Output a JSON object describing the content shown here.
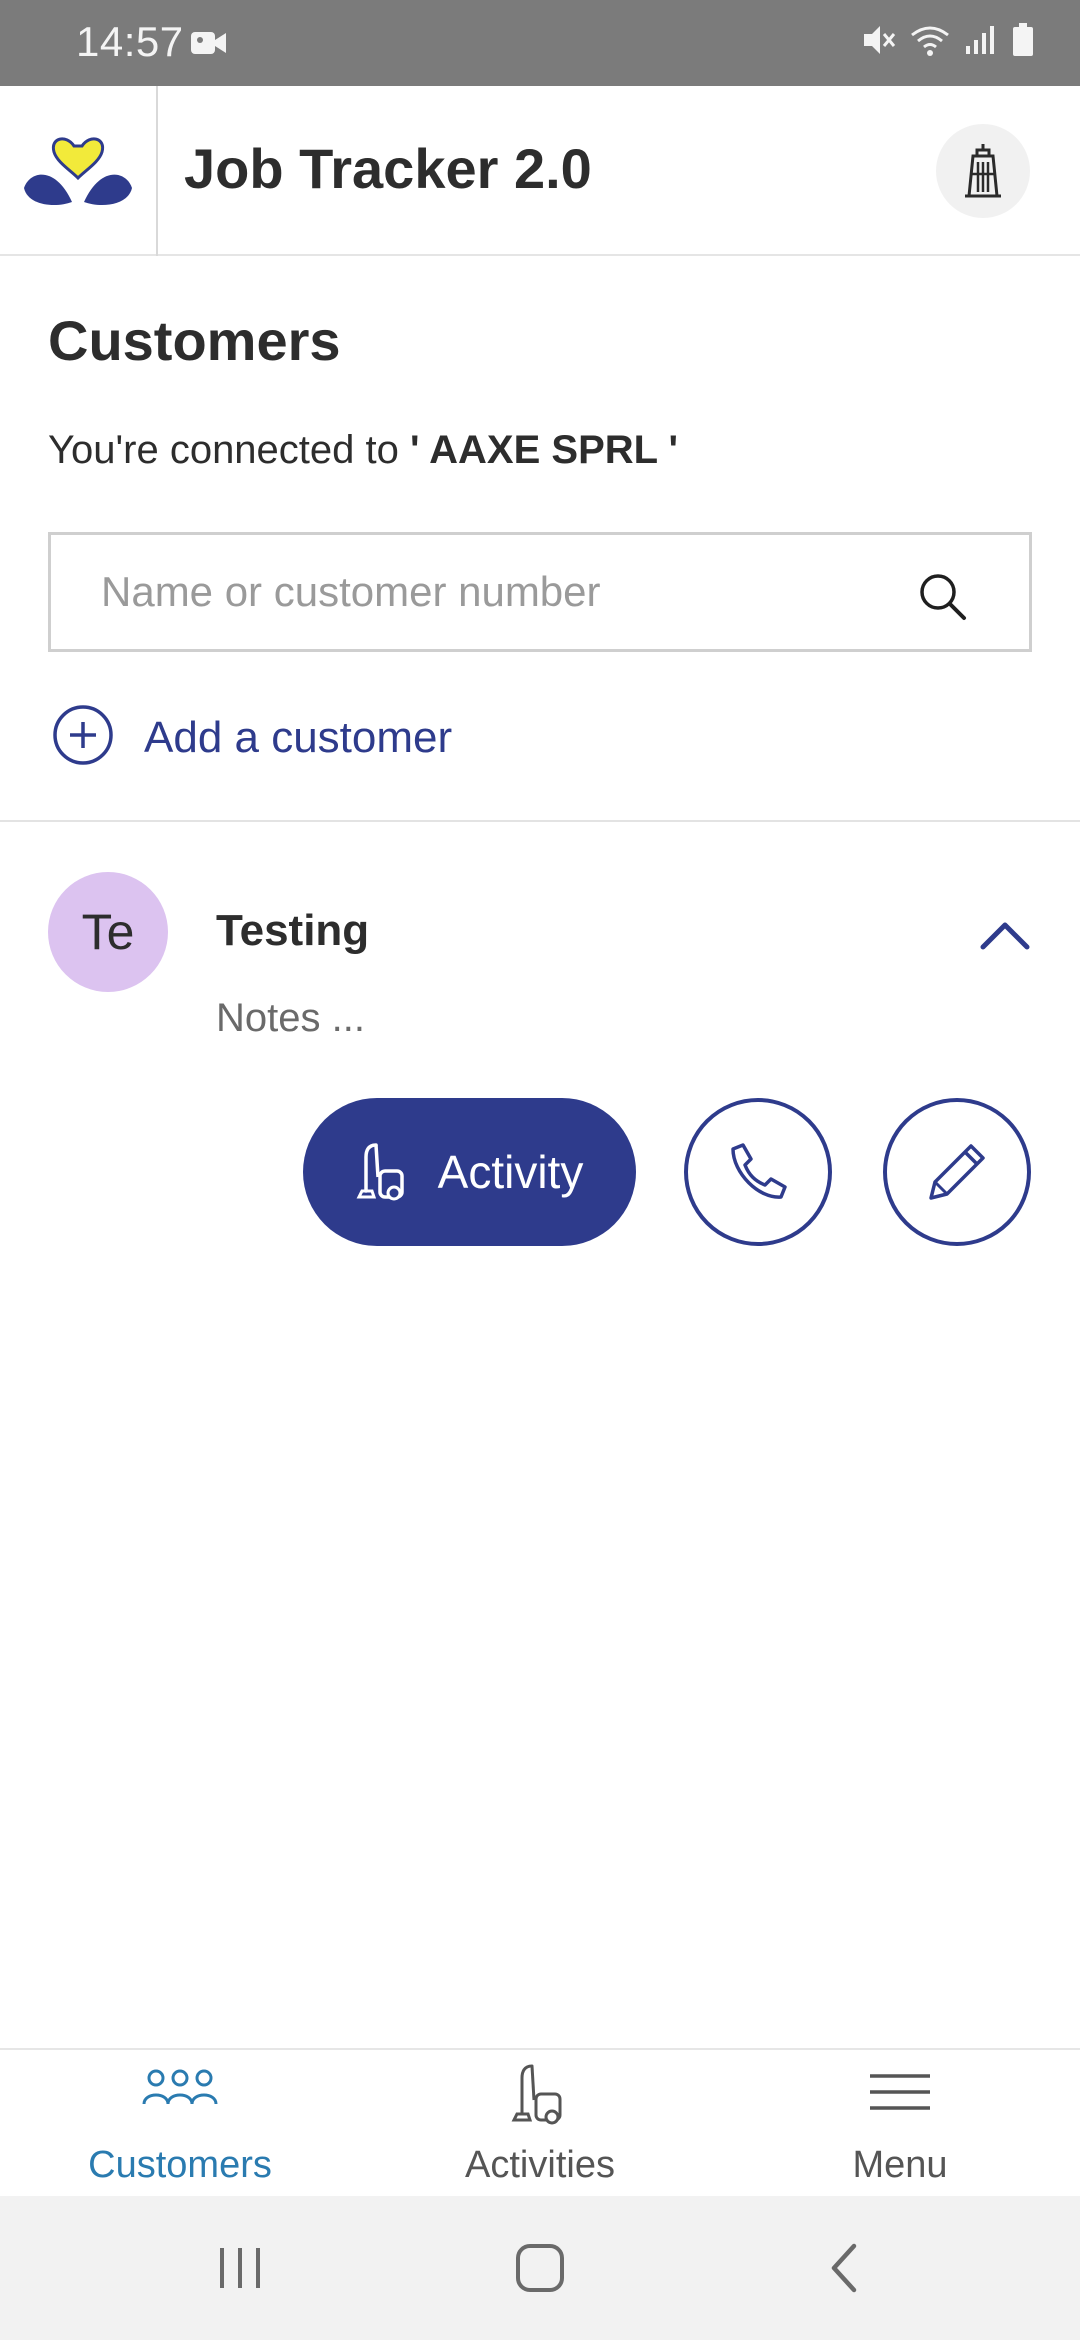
{
  "status_bar": {
    "time": "14:57"
  },
  "header": {
    "title": "Job Tracker 2.0"
  },
  "page": {
    "title": "Customers",
    "connection_prefix": "You're connected to",
    "company": "' AAXE SPRL '"
  },
  "search": {
    "placeholder": "Name or customer number",
    "value": ""
  },
  "add_customer": {
    "label": "Add a customer"
  },
  "customers": [
    {
      "initials": "Te",
      "name": "Testing",
      "notes": "Notes ...",
      "expanded": true,
      "actions": {
        "activity_label": "Activity"
      }
    }
  ],
  "bottom_nav": {
    "items": [
      {
        "label": "Customers",
        "icon": "users-icon",
        "active": true
      },
      {
        "label": "Activities",
        "icon": "vacuum-icon",
        "active": false
      },
      {
        "label": "Menu",
        "icon": "hamburger-icon",
        "active": false
      }
    ]
  },
  "colors": {
    "primary": "#2e3b8c",
    "active_nav": "#2a7bb0",
    "avatar_bg": "#dcc3f0",
    "status_bar": "#7b7b7b",
    "logo_yellow": "#f2ea3a"
  }
}
